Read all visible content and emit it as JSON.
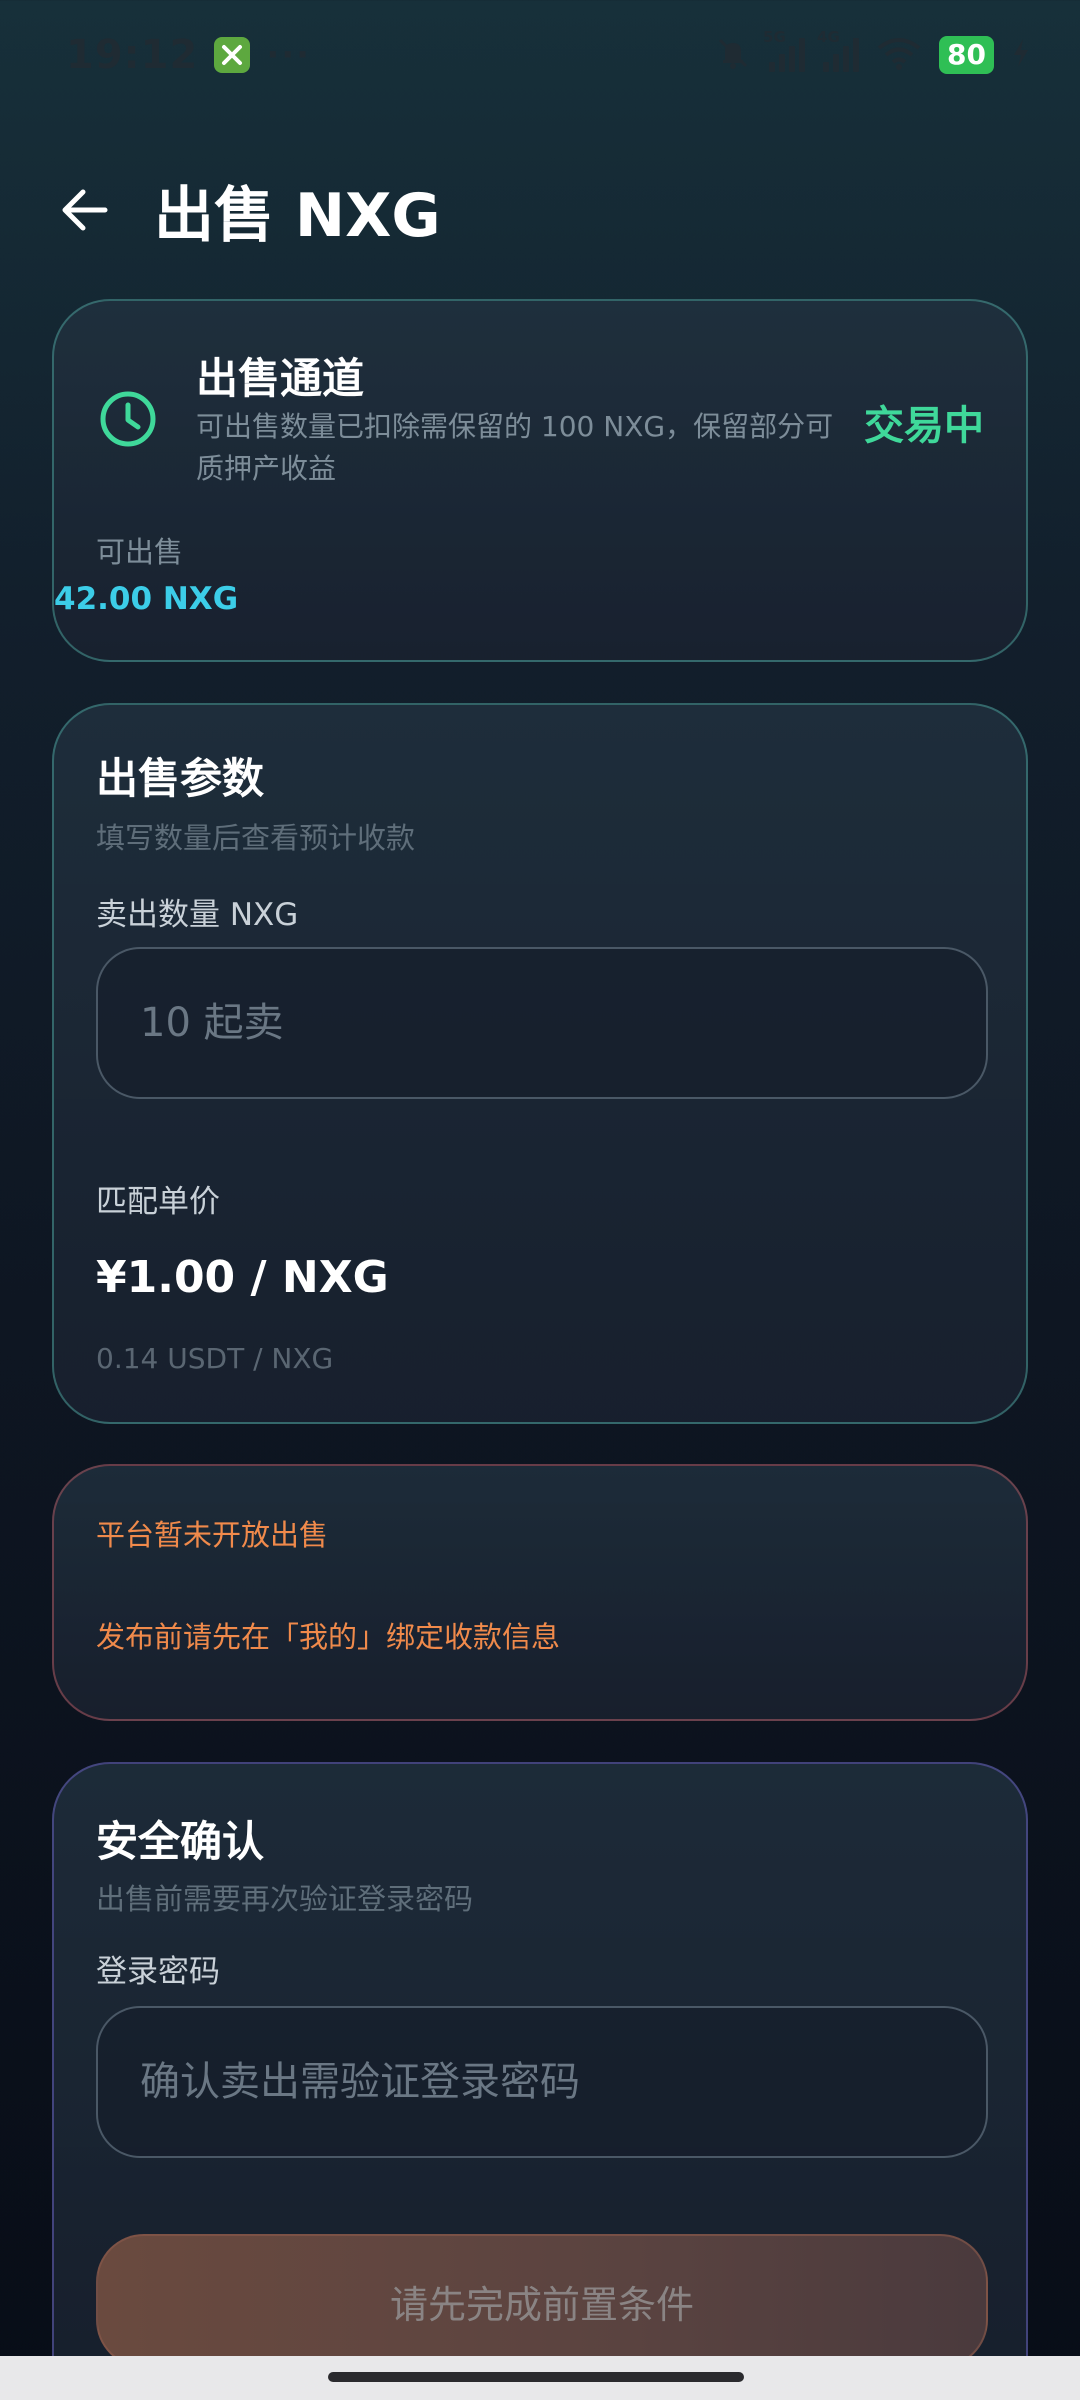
{
  "status_bar": {
    "time": "19:12",
    "dots": "···",
    "signal_1_tag": "5G",
    "signal_2_tag": "4G",
    "battery": "80",
    "icons": [
      "notifications-off-icon",
      "signal-5g-icon",
      "signal-4g-icon",
      "wifi-icon",
      "battery-icon",
      "charging-icon"
    ]
  },
  "header": {
    "title": "出售 NXG",
    "back_icon": "arrow-left-icon"
  },
  "channel": {
    "title": "出售通道",
    "description": "可出售数量已扣除需保留的 100 NXG，保留部分可质押产收益",
    "status": "交易中",
    "available_label": "可出售",
    "available_value": "42.00 NXG",
    "icon": "clock-icon"
  },
  "params": {
    "title": "出售参数",
    "subtitle": "填写数量后查看预计收款",
    "quantity_label": "卖出数量 NXG",
    "quantity_placeholder": "10 起卖",
    "quantity_value": "",
    "price_label": "匹配单价",
    "price_value": "¥1.00 / NXG",
    "price_usdt": "0.14 USDT / NXG"
  },
  "warnings": {
    "line1": "平台暂未开放出售",
    "line2": "发布前请先在「我的」绑定收款信息"
  },
  "security": {
    "title": "安全确认",
    "subtitle": "出售前需要再次验证登录密码",
    "password_label": "登录密码",
    "password_placeholder": "确认卖出需验证登录密码",
    "password_value": "",
    "submit_label": "请先完成前置条件"
  },
  "colors": {
    "accent_green": "#3fd89a",
    "accent_cyan": "#3ccde8",
    "warning_orange": "#f08a4b",
    "battery_green": "#2fbf55"
  }
}
